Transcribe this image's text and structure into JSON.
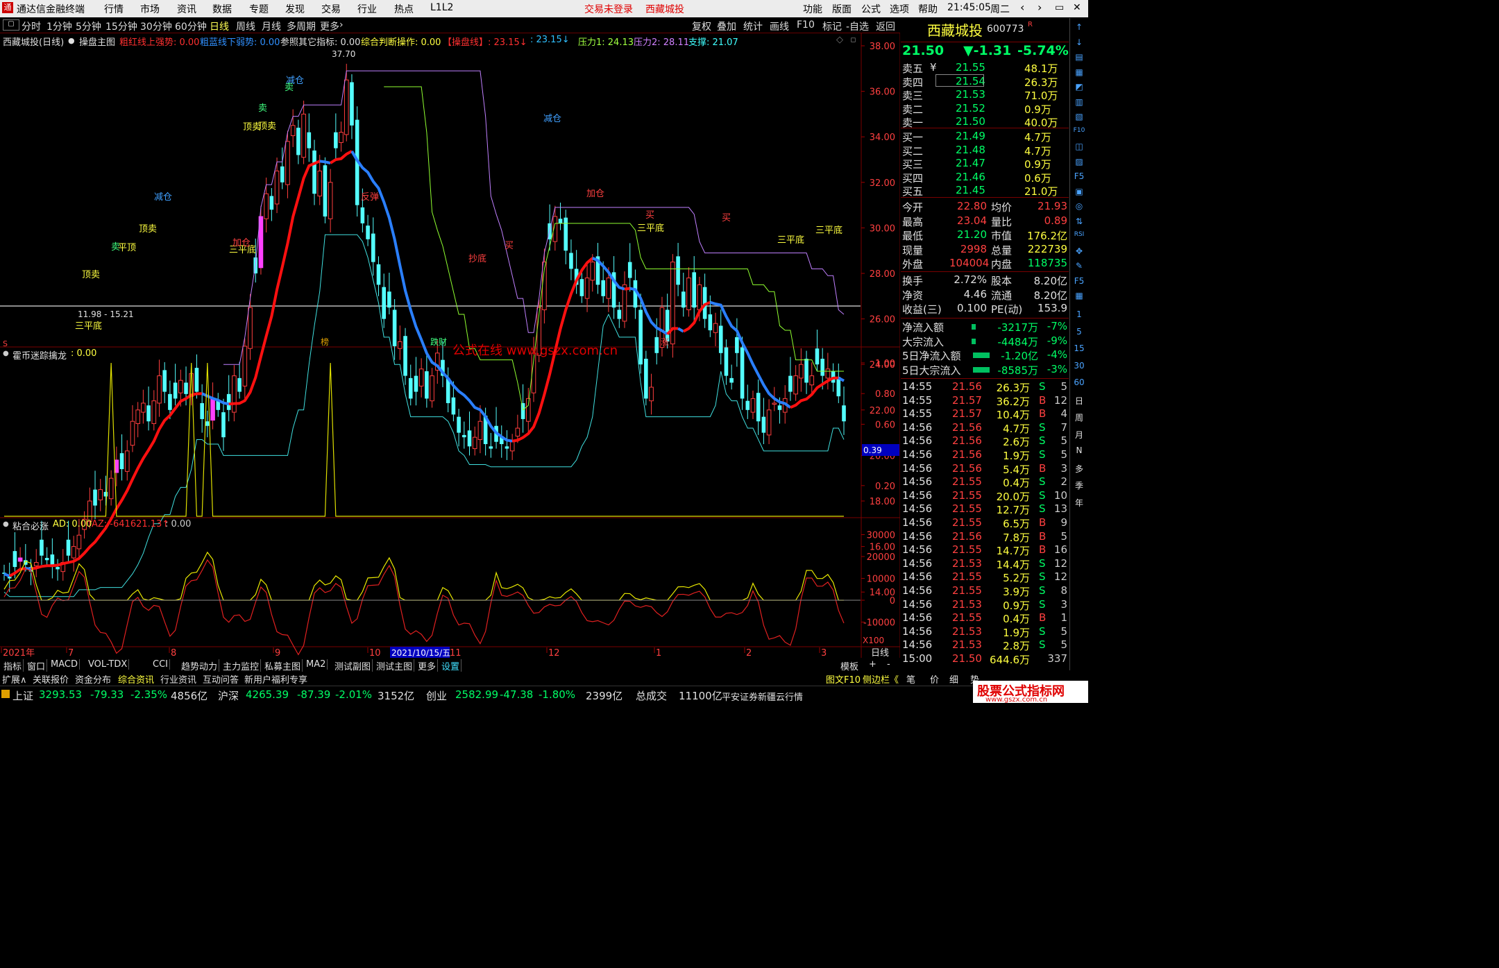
{
  "app": {
    "title": "通达信金融终端",
    "logo": "通",
    "menus": [
      "行情",
      "市场",
      "资讯",
      "数据",
      "专题",
      "发现",
      "交易",
      "行业",
      "热点",
      "L1L2"
    ],
    "login_status": "交易未登录",
    "stock_name_title": "西藏城投",
    "right_menus": [
      "功能",
      "版面",
      "公式",
      "选项",
      "帮助"
    ],
    "clock": "21:45:05",
    "weekday": "周二",
    "window_controls": [
      "‹",
      "›",
      "▭",
      "✕"
    ]
  },
  "periods": {
    "items": [
      "分时",
      "1分钟",
      "5分钟",
      "15分钟",
      "30分钟",
      "60分钟",
      "日线",
      "周线",
      "月线",
      "多周期",
      "更多"
    ],
    "active": "日线",
    "more_arrow": "›"
  },
  "toolbar_right": [
    "复权",
    "叠加",
    "统计",
    "画线",
    "F10",
    "标记",
    "-自选",
    "返回"
  ],
  "main_indicator": {
    "title": "西藏城投(日线)",
    "formula": "操盘主图",
    "items": [
      {
        "text": "粗红线上强势: 0.00",
        "color": "#ff3030"
      },
      {
        "text": "粗蓝线下弱势: 0.00",
        "color": "#3090ff"
      },
      {
        "text": "参照其它指标: 0.00",
        "color": "#e0e0e0"
      },
      {
        "text": "综合判断操作: 0.00",
        "color": "#ffff40"
      },
      {
        "text": "【操盘线】: 23.15↓",
        "color": "#ff3030"
      },
      {
        "text": ": 23.15↓",
        "color": "#30c0ff"
      },
      {
        "text": "压力1: 24.13",
        "color": "#a0ff40"
      },
      {
        "text": "压力2: 28.11",
        "color": "#d080ff"
      },
      {
        "text": "支撑: 21.07",
        "color": "#40ffff"
      }
    ]
  },
  "price_axis": {
    "labels": [
      "38.00",
      "36.00",
      "34.00",
      "32.00",
      "30.00",
      "28.00",
      "26.00",
      "24.00",
      "22.00",
      "20.00",
      "18.00",
      "16.00",
      "14.00"
    ]
  },
  "annotations": {
    "high_label": "37.70",
    "low_label": "11.98 - 15.21",
    "watermark": "公式在线  www.gszx.com.cn",
    "signals": [
      "顶卖",
      "顶卖",
      "顶卖",
      "减仓",
      "减仓",
      "减仓",
      "卖",
      "卖",
      "卖",
      "三平底",
      "三平底",
      "三平底",
      "三平底",
      "三平底",
      "加仓",
      "加仓",
      "买",
      "买",
      "买",
      "抄底",
      "反弹",
      "顶卖",
      "平顶"
    ],
    "bottom_tags": [
      "榜",
      "跌财",
      "涨"
    ],
    "left_marker": "S"
  },
  "sub1": {
    "title": "霍币迷踪擒龙",
    "value": ": 0.00",
    "axis": [
      "1.00",
      "0.80",
      "0.60",
      "0.20"
    ],
    "cursor_value": "0.39"
  },
  "sub2": {
    "title": "粘合必涨",
    "ad": "AD: 0.00",
    "az": "AZ: -641621.13↑",
    "extra": ": 0.00",
    "axis": [
      "30000",
      "20000",
      "10000",
      "0",
      "-10000"
    ],
    "scale": "X100"
  },
  "date_axis": {
    "labels": [
      "2021年",
      "7",
      "8",
      "9",
      "10",
      "11",
      "12",
      "1",
      "2",
      "3"
    ],
    "cursor_date": "2021/10/15/五",
    "unit": "日线"
  },
  "chart_data": [
    {
      "type": "candlestick",
      "title": "西藏城投(日线)",
      "ylim": [
        13,
        38.5
      ],
      "close": [
        14.8,
        14.6,
        15.1,
        15.5,
        15.2,
        14.9,
        15.3,
        15.6,
        15.4,
        15.2,
        15.0,
        15.3,
        15.6,
        16.0,
        16.5,
        17.2,
        18.0,
        17.8,
        18.5,
        18.2,
        19.0,
        19.8,
        19.4,
        20.2,
        21.5,
        22.0,
        22.3,
        21.5,
        22.4,
        23.5,
        22.8,
        22.0,
        22.5,
        23.3,
        22.7,
        23.6,
        22.8,
        21.6,
        21.3,
        22.5,
        22.0,
        20.8,
        22.0,
        23.5,
        22.8,
        24.8,
        26.5,
        28.0,
        30.5,
        31.5,
        30.8,
        32.5,
        32.0,
        33.8,
        34.5,
        33.2,
        35.0,
        33.5,
        31.5,
        32.5,
        30.5,
        32.0,
        33.5,
        34.2,
        36.5,
        34.5,
        31.0,
        30.2,
        29.5,
        28.5,
        27.5,
        26.0,
        26.5,
        24.8,
        25.0,
        23.5,
        22.5,
        22.8,
        23.8,
        22.5,
        23.5,
        24.5,
        23.5,
        22.3,
        21.8,
        21.0,
        20.8,
        20.4,
        20.8,
        21.5,
        20.5,
        20.3,
        20.6,
        20.5,
        20.3,
        20.6,
        21.2,
        21.6,
        22.5,
        24.5,
        26.5,
        28.5,
        29.5,
        30.5,
        30.2,
        29.0,
        28.2,
        27.5,
        27.0,
        27.8,
        28.5,
        27.5,
        27.0,
        27.8,
        26.5,
        26.0,
        27.5,
        27.8,
        26.5,
        24.0,
        22.5,
        23.0,
        24.5,
        26.5,
        25.0,
        28.5,
        27.5,
        26.5,
        27.8,
        26.5,
        27.5,
        26.0,
        25.5,
        25.8,
        24.5,
        23.5,
        23.2,
        24.5,
        22.5,
        22.0,
        22.5,
        21.5,
        21.0,
        22.0,
        22.3,
        22.0,
        22.5,
        22.8,
        23.5,
        24.0,
        23.2,
        23.5,
        24.0,
        23.5,
        23.8,
        23.2,
        22.6,
        21.5
      ],
      "axis_ticks": [
        38,
        36,
        34,
        32,
        30,
        28,
        26,
        24,
        22,
        20,
        18,
        16,
        14
      ]
    },
    {
      "type": "line",
      "title": "霍币迷踪擒龙",
      "ylim": [
        0,
        1.1
      ],
      "spikes_at": [
        20,
        35,
        38,
        61
      ],
      "value": 0.0
    },
    {
      "type": "line",
      "title": "粘合必涨",
      "series": [
        {
          "name": "AD",
          "color": "#e8e800"
        },
        {
          "name": "AZ",
          "color": "#e02020"
        }
      ],
      "ylim": [
        -18000,
        32000
      ]
    }
  ],
  "quote": {
    "name": "西藏城投",
    "code": "600773",
    "badge": "R",
    "price": "21.50",
    "change": "▼-1.31",
    "pct": "-5.74%",
    "asks": [
      {
        "label": "卖五",
        "tag": "¥",
        "price": "21.55",
        "vol": "48.1万"
      },
      {
        "label": "卖四",
        "price": "21.54",
        "vol": "26.3万"
      },
      {
        "label": "卖三",
        "price": "21.53",
        "vol": "71.0万"
      },
      {
        "label": "卖二",
        "price": "21.52",
        "vol": "0.9万"
      },
      {
        "label": "卖一",
        "price": "21.50",
        "vol": "40.0万"
      }
    ],
    "bids": [
      {
        "label": "买一",
        "price": "21.49",
        "vol": "4.7万"
      },
      {
        "label": "买二",
        "price": "21.48",
        "vol": "4.7万"
      },
      {
        "label": "买三",
        "price": "21.47",
        "vol": "0.9万"
      },
      {
        "label": "买四",
        "price": "21.46",
        "vol": "0.6万"
      },
      {
        "label": "买五",
        "price": "21.45",
        "vol": "21.0万"
      }
    ],
    "stats1": [
      [
        "今开",
        "22.80",
        "均价",
        "21.93"
      ],
      [
        "最高",
        "23.04",
        "量比",
        "0.89"
      ],
      [
        "最低",
        "21.20",
        "市值",
        "176.2亿"
      ],
      [
        "现量",
        "2998",
        "总量",
        "222739"
      ],
      [
        "外盘",
        "104004",
        "内盘",
        "118735"
      ]
    ],
    "stats2": [
      [
        "换手",
        "2.72%",
        "股本",
        "8.20亿"
      ],
      [
        "净资",
        "4.46",
        "流通",
        "8.20亿"
      ],
      [
        "收益(三)",
        "0.100",
        "PE(动)",
        "153.9"
      ]
    ],
    "flows": [
      [
        "净流入额",
        "-3217万",
        "-7%"
      ],
      [
        "大宗流入",
        "-4484万",
        "-9%"
      ],
      [
        "5日净流入额",
        "-1.20亿",
        "-4%"
      ],
      [
        "5日大宗流入",
        "-8585万",
        "-3%"
      ]
    ],
    "ticks": [
      [
        "14:55",
        "21.56",
        "26.3万",
        "S",
        "5"
      ],
      [
        "14:55",
        "21.57",
        "36.2万",
        "B",
        "12"
      ],
      [
        "14:55",
        "21.57",
        "10.4万",
        "B",
        "4"
      ],
      [
        "14:56",
        "21.56",
        "4.7万",
        "S",
        "7"
      ],
      [
        "14:56",
        "21.56",
        "2.6万",
        "S",
        "5"
      ],
      [
        "14:56",
        "21.56",
        "1.9万",
        "S",
        "5"
      ],
      [
        "14:56",
        "21.56",
        "5.4万",
        "B",
        "3"
      ],
      [
        "14:56",
        "21.55",
        "0.4万",
        "S",
        "2"
      ],
      [
        "14:56",
        "21.55",
        "20.0万",
        "S",
        "10"
      ],
      [
        "14:56",
        "21.55",
        "12.7万",
        "S",
        "13"
      ],
      [
        "14:56",
        "21.55",
        "6.5万",
        "B",
        "9"
      ],
      [
        "14:56",
        "21.56",
        "7.8万",
        "B",
        "5"
      ],
      [
        "14:56",
        "21.55",
        "14.7万",
        "B",
        "16"
      ],
      [
        "14:56",
        "21.53",
        "14.4万",
        "S",
        "12"
      ],
      [
        "14:56",
        "21.55",
        "5.2万",
        "S",
        "12"
      ],
      [
        "14:56",
        "21.55",
        "3.9万",
        "S",
        "8"
      ],
      [
        "14:56",
        "21.53",
        "0.9万",
        "S",
        "3"
      ],
      [
        "14:56",
        "21.55",
        "0.4万",
        "B",
        "1"
      ],
      [
        "14:56",
        "21.53",
        "1.9万",
        "S",
        "5"
      ],
      [
        "14:56",
        "21.53",
        "2.8万",
        "S",
        "5"
      ],
      [
        "15:00",
        "21.50",
        "644.6万",
        "",
        "337"
      ]
    ]
  },
  "right_tools": [
    "↑",
    "↓",
    "▤",
    "▦",
    "◩",
    "▥",
    "▧",
    "F10",
    "◫",
    "▨",
    "F5",
    "▣",
    "◎",
    "⇅",
    "RSI",
    "✥",
    "✎",
    "F5",
    "▦",
    "1",
    "5",
    "15",
    "30",
    "60",
    "日",
    "周",
    "月",
    "N",
    "多",
    "季",
    "年"
  ],
  "bottom_tabs": [
    "指标",
    "窗口",
    "MACD",
    "VOL-TDX",
    "CCI",
    "趋势动力",
    "主力监控",
    "私募主图",
    "MA2",
    "测试副图",
    "测试主图",
    "更多",
    "设置"
  ],
  "bottom_tabs_right": [
    "模板",
    "+",
    "-"
  ],
  "bottom_bar2": [
    "扩展∧",
    "关联报价",
    "资金分布",
    "综合资讯",
    "行业资讯",
    "互动问答",
    "新用户福利专享"
  ],
  "bottom_bar2_right": [
    "图文F10",
    "侧边栏《",
    "笔",
    "价",
    "细",
    "势"
  ],
  "status": {
    "sh_label": "上证",
    "sh": "3293.53",
    "sh_chg": "-79.33",
    "sh_pct": "-2.35%",
    "sh_amt": "4856亿",
    "sz_label": "沪深",
    "sz": "4265.39",
    "sz_chg": "-87.39",
    "sz_pct": "-2.01%",
    "sz_amt": "3152亿",
    "cy_label": "创业",
    "cy": "2582.99",
    "cy_chg": "-47.38",
    "cy_pct": "-1.80%",
    "cy_amt": "2399亿",
    "total_label": "总成交",
    "total": "11100亿",
    "broker": "平安证券新疆云行情",
    "logo_cn": "股票公式指标网",
    "logo_url": "www.gszx.com.cn"
  }
}
